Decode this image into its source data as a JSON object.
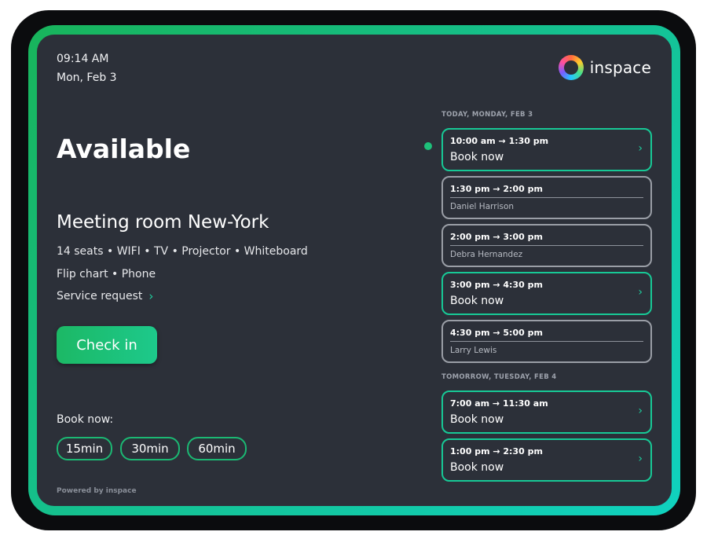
{
  "device": {
    "frame_gradient": [
      "#18b45b",
      "#10d2bf"
    ],
    "screen_color": "#2c3039"
  },
  "header": {
    "time": "09:14 AM",
    "date": "Mon, Feb 3",
    "brand": "inspace",
    "logo_icon": "inspace-ring-logo"
  },
  "room": {
    "status": "Available",
    "name": "Meeting room New-York",
    "amenities_line1": "14 seats • WIFI • TV • Projector • Whiteboard",
    "amenities_line2": "Flip chart • Phone",
    "service_request": "Service request",
    "service_chevron": "›"
  },
  "actions": {
    "check_in": "Check in",
    "book_now_label": "Book now:",
    "durations": [
      "15min",
      "30min",
      "60min"
    ]
  },
  "footer": {
    "powered_by": "Powered by inspace"
  },
  "schedule": {
    "today_label": "TODAY, MONDAY, FEB 3",
    "tomorrow_label": "TOMORROW, TUESDAY, FEB 4",
    "today": [
      {
        "time": "10:00 am → 1:30 pm",
        "status": "free",
        "action": "Book now",
        "chevron": "›"
      },
      {
        "time": "1:30 pm → 2:00 pm",
        "status": "booked",
        "organizer": "Daniel Harrison"
      },
      {
        "time": "2:00 pm → 3:00 pm",
        "status": "booked",
        "organizer": "Debra Hernandez"
      },
      {
        "time": "3:00 pm → 4:30 pm",
        "status": "free",
        "action": "Book now",
        "chevron": "›"
      },
      {
        "time": "4:30 pm → 5:00 pm",
        "status": "booked",
        "organizer": "Larry Lewis"
      }
    ],
    "tomorrow": [
      {
        "time": "7:00 am → 11:30 am",
        "status": "free",
        "action": "Book now",
        "chevron": "›"
      },
      {
        "time": "1:00 pm → 2:30 pm",
        "status": "free",
        "action": "Book now",
        "chevron": "›"
      }
    ]
  },
  "colors": {
    "accent": "#1fd09f",
    "free_border": "#17c996",
    "booked_border": "#9a9ea6",
    "current_dot": "#1ec07a"
  }
}
